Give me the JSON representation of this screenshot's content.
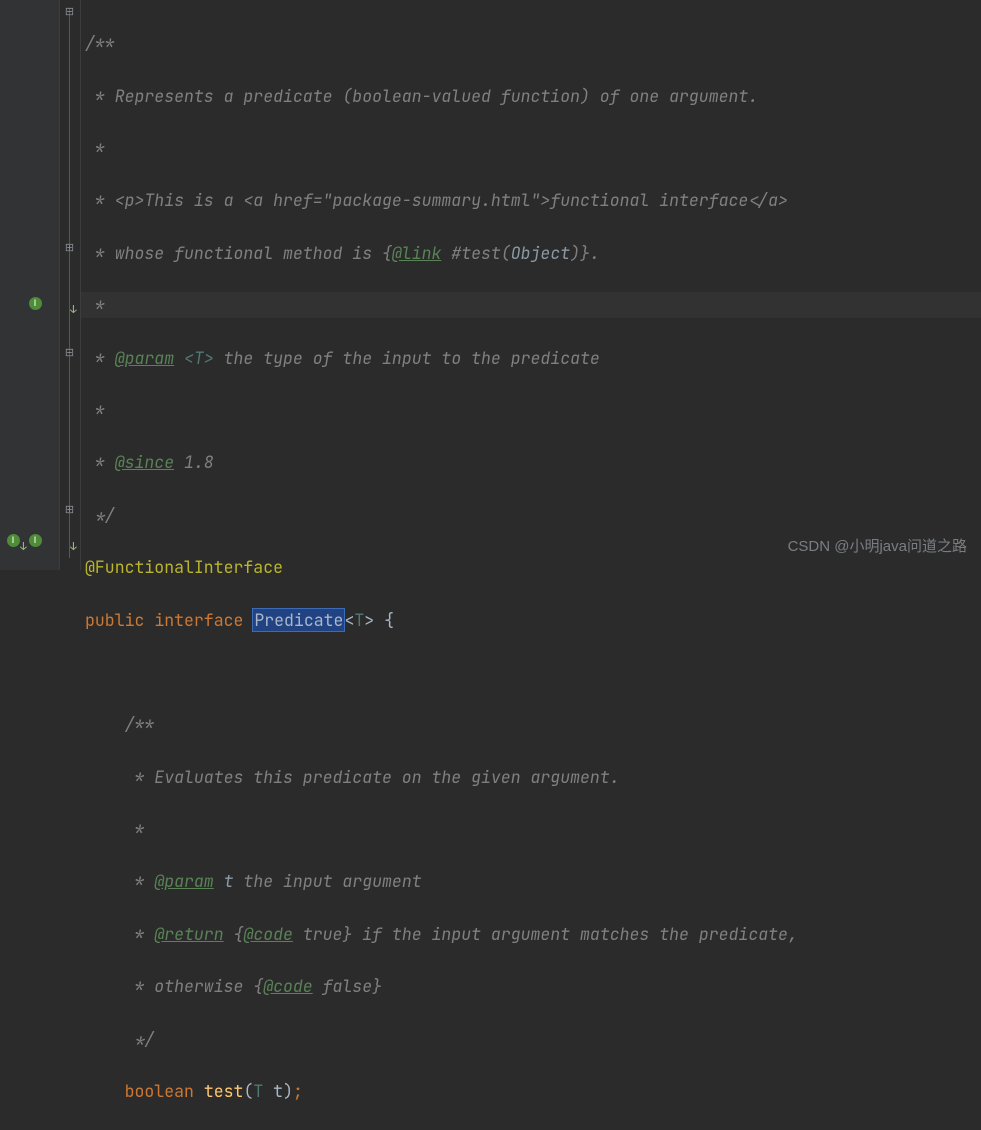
{
  "gutter_icons": {
    "implemented": "I",
    "implemented_tip": "Has implementations"
  },
  "code": {
    "l1a": "/**",
    "l2a": " * Represents a predicate (boolean-valued function) of one argument.",
    "l3a": " *",
    "l4a": " * <p>This is a ",
    "l4b": "<a href=\"package-summary.html\">",
    "l4c": "functional interface",
    "l4d": "</a>",
    "l5a": " * whose functional method is {",
    "l5b": "@link",
    "l5c": " #test(",
    "l5d": "Object",
    "l5e": ")}.",
    "l6a": " *",
    "l7a": " * ",
    "l7b": "@param",
    "l7c": " ",
    "l7d": "<T>",
    "l7e": " the type of the input to the predicate",
    "l8a": " *",
    "l9a": " * ",
    "l9b": "@since",
    "l9c": " 1.8",
    "l10a": " */",
    "l11a": "@FunctionalInterface",
    "l12a": "public",
    "l12b": " ",
    "l12c": "interface",
    "l12d": " ",
    "l12e": "Predicate",
    "l12f": "<",
    "l12g": "T",
    "l12h": ">",
    "l12i": " ",
    "l12j": "{",
    "l13a": "",
    "l14a": "    /**",
    "l15a": "     * Evaluates this predicate on the given argument.",
    "l16a": "     *",
    "l17a": "     * ",
    "l17b": "@param",
    "l17c": " ",
    "l17d": "t",
    "l17e": " the input argument",
    "l18a": "     * ",
    "l18b": "@return",
    "l18c": " {",
    "l18d": "@code",
    "l18e": " true} if the input argument matches the predicate,",
    "l19a": "     * otherwise {",
    "l19b": "@code",
    "l19c": " false}",
    "l20a": "     */",
    "l21a": "    ",
    "l21b": "boolean",
    "l21c": " ",
    "l21d": "test",
    "l21e": "(",
    "l21f": "T",
    "l21g": " ",
    "l21h": "t",
    "l21i": ")",
    "l21j": ";"
  },
  "watermark": "CSDN @小明java问道之路"
}
